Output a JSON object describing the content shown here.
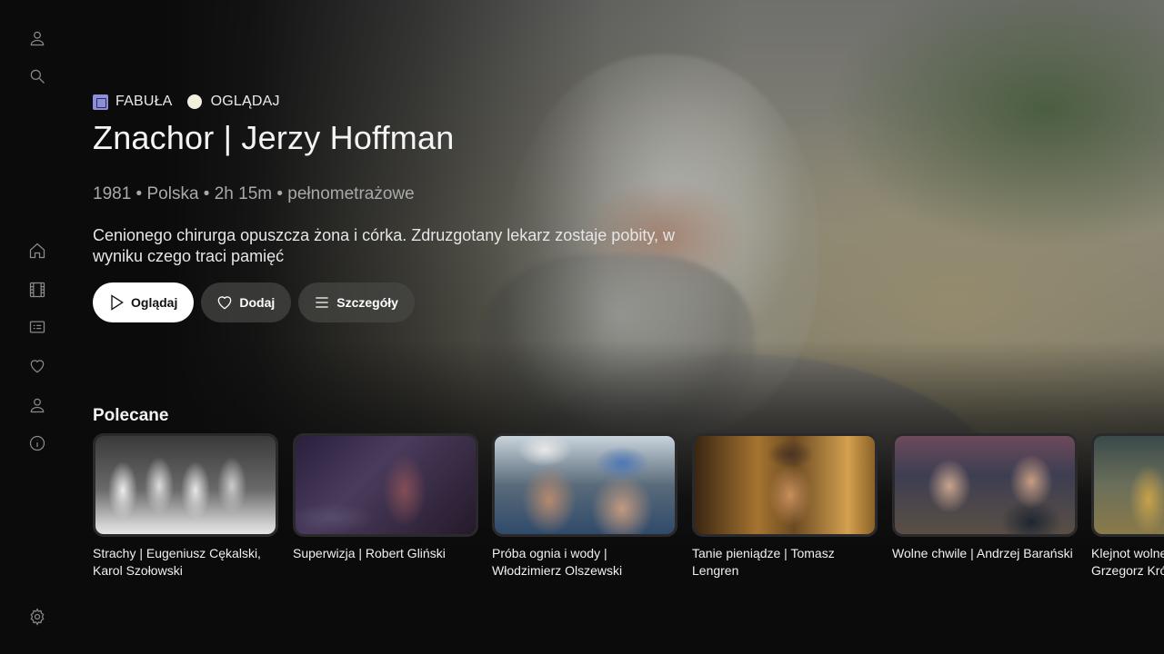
{
  "sidebar": {
    "items": [
      {
        "icon": "user-icon",
        "label": "Profil"
      },
      {
        "icon": "search-icon",
        "label": "Szukaj"
      },
      {
        "icon": "home-icon",
        "label": "Strona główna"
      },
      {
        "icon": "film-icon",
        "label": "Filmy"
      },
      {
        "icon": "ticket-icon",
        "label": "Kolekcje"
      },
      {
        "icon": "heart-icon",
        "label": "Ulubione"
      },
      {
        "icon": "user-icon",
        "label": "Konto"
      },
      {
        "icon": "info-icon",
        "label": "Informacje"
      },
      {
        "icon": "gear-icon",
        "label": "Ustawienia"
      }
    ]
  },
  "hero": {
    "tags": [
      {
        "icon": "square-icon",
        "label": "FABUŁA",
        "color": "#8d8ed8"
      },
      {
        "icon": "dot-icon",
        "label": "OGLĄDAJ",
        "color": "#f2efdc"
      }
    ],
    "title": "Znachor | Jerzy Hoffman",
    "meta": "1981 • Polska • 2h 15m • pełnometrażowe",
    "description": "Cenionego chirurga opuszcza żona i córka. Zdruzgotany lekarz zostaje pobity, w wyniku czego traci pamięć",
    "actions": {
      "watch": "Oglądaj",
      "add": "Dodaj",
      "details": "Szczegóły"
    }
  },
  "recommended": {
    "title": "Polecane",
    "items": [
      {
        "title": "Strachy | Eugeniusz Cękalski, Karol Szołowski"
      },
      {
        "title": "Superwizja | Robert Gliński"
      },
      {
        "title": "Próba ognia i wody | Włodzimierz Olszewski"
      },
      {
        "title": "Tanie pieniądze | Tomasz Lengren"
      },
      {
        "title": "Wolne chwile | Andrzej Barański"
      },
      {
        "title": "Klejnot wolnego sumienia | Grzegorz Królikiewicz"
      }
    ]
  },
  "colors": {
    "background": "#0b0b0c",
    "primary_button": "#ffffff",
    "secondary_button": "#464644"
  }
}
